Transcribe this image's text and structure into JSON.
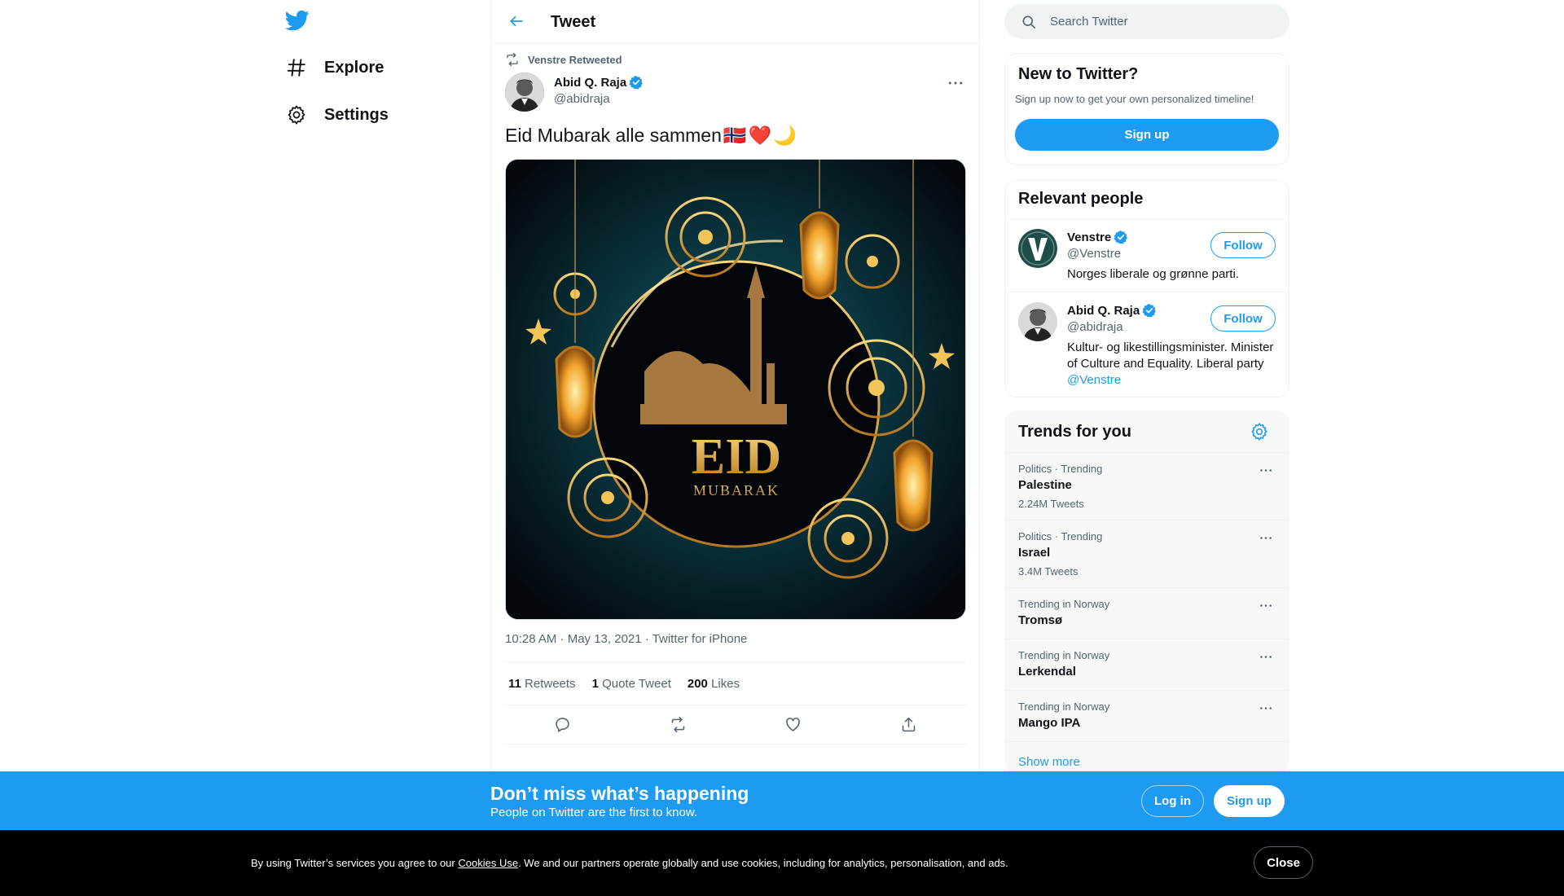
{
  "brand": {
    "accent": "#1d9bf0",
    "text": "#0f1419",
    "muted": "#536471"
  },
  "nav": {
    "logo_icon": "twitter-bird-icon",
    "items": [
      {
        "label": "Explore",
        "icon": "hashtag-icon"
      },
      {
        "label": "Settings",
        "icon": "gear-icon"
      }
    ]
  },
  "header": {
    "title": "Tweet",
    "back_icon": "arrow-left-icon"
  },
  "tweet": {
    "social_context": "Venstre Retweeted",
    "author_name": "Abid Q. Raja",
    "author_handle": "@abidraja",
    "text": "Eid Mubarak alle sammen",
    "emojis": [
      "🇳🇴",
      "❤️",
      "🌙"
    ],
    "media_text": {
      "title": "EID",
      "subtitle": "MUBARAK"
    },
    "meta": "10:28 AM · May 13, 2021 · Twitter for iPhone",
    "stats": [
      {
        "count": "11",
        "label": "Retweets"
      },
      {
        "count": "1",
        "label": "Quote Tweet"
      },
      {
        "count": "200",
        "label": "Likes"
      }
    ],
    "actions": [
      "reply-icon",
      "retweet-icon",
      "like-icon",
      "share-icon"
    ]
  },
  "search": {
    "placeholder": "Search Twitter",
    "value": ""
  },
  "new_to_twitter": {
    "title": "New to Twitter?",
    "subtitle": "Sign up now to get your own personalized timeline!",
    "button": "Sign up"
  },
  "relevant_people": {
    "title": "Relevant people",
    "people": [
      {
        "name": "Venstre",
        "handle": "@Venstre",
        "bio": "Norges liberale og grønne parti.",
        "button": "Follow",
        "verified": true
      },
      {
        "name": "Abid Q. Raja",
        "handle": "@abidraja",
        "bio": "Kultur- og likestillingsminister. Minister of Culture and Equality. Liberal party ",
        "bio_mention": "@Venstre",
        "button": "Follow",
        "verified": true
      }
    ]
  },
  "trends": {
    "title": "Trends for you",
    "items": [
      {
        "context": "Politics · Trending",
        "name": "Palestine",
        "count": "2.24M Tweets"
      },
      {
        "context": "Politics · Trending",
        "name": "Israel",
        "count": "3.4M Tweets"
      },
      {
        "context": "Trending in Norway",
        "name": "Tromsø",
        "count": ""
      },
      {
        "context": "Trending in Norway",
        "name": "Lerkendal",
        "count": ""
      },
      {
        "context": "Trending in Norway",
        "name": "Mango IPA",
        "count": ""
      }
    ],
    "show_more": "Show more"
  },
  "signup_bar": {
    "title": "Don’t miss what’s happening",
    "subtitle": "People on Twitter are the first to know.",
    "login": "Log in",
    "signup": "Sign up"
  },
  "cookie_bar": {
    "text_before": "By using Twitter’s services you agree to our ",
    "link": "Cookies Use",
    "text_after": ". We and our partners operate globally and use cookies, including for analytics, personalisation, and ads.",
    "close": "Close"
  }
}
